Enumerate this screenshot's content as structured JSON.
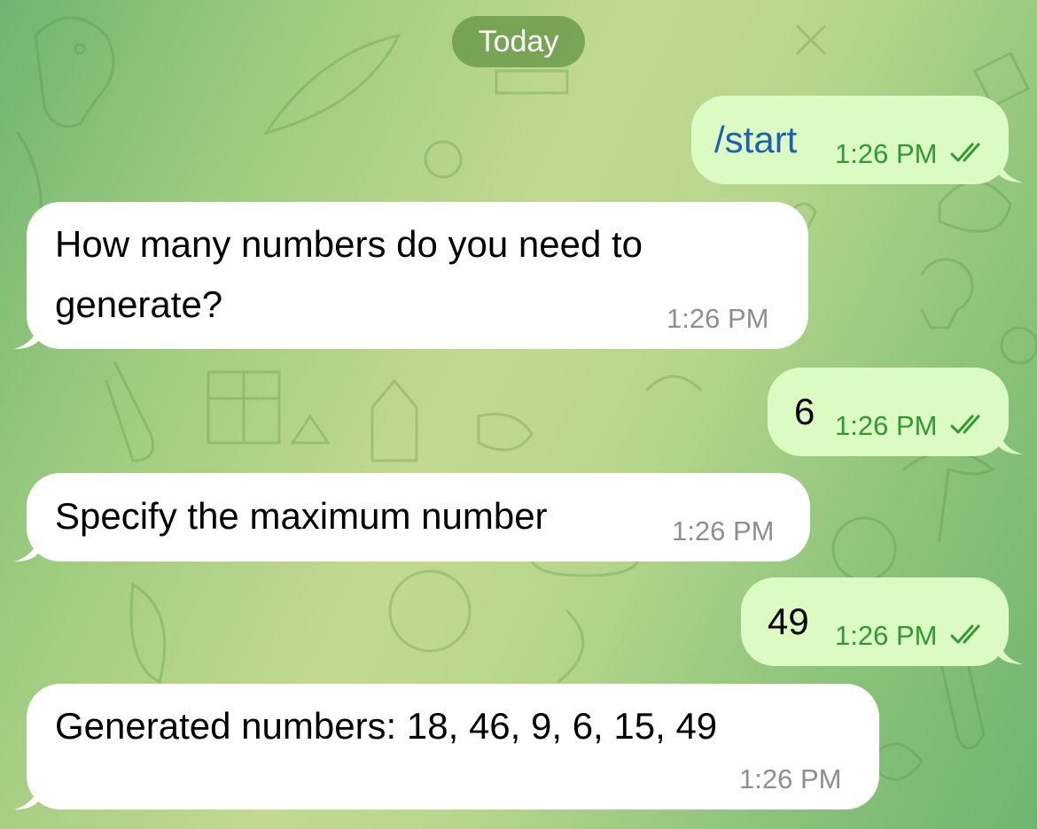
{
  "date_separator": "Today",
  "messages": [
    {
      "direction": "outgoing",
      "text": "/start",
      "is_command": true,
      "time": "1:26 PM",
      "status": "read"
    },
    {
      "direction": "incoming",
      "lines": [
        "How many numbers do you need to",
        "generate?"
      ],
      "time": "1:26 PM"
    },
    {
      "direction": "outgoing",
      "text": "6",
      "time": "1:26 PM",
      "status": "read"
    },
    {
      "direction": "incoming",
      "text": "Specify the maximum number",
      "time": "1:26 PM"
    },
    {
      "direction": "outgoing",
      "text": "49",
      "time": "1:26 PM",
      "status": "read"
    },
    {
      "direction": "incoming",
      "text": "Generated numbers: 18, 46, 9, 6, 15, 49",
      "time": "1:26 PM"
    }
  ],
  "icons": {
    "read_status": "double-check-icon",
    "wallpaper": "doodle-pattern"
  },
  "colors": {
    "incoming_bubble": "#ffffff",
    "outgoing_bubble": "#dcfbc2",
    "outgoing_time": "#2f9a33",
    "incoming_time": "#8e8e93",
    "command_link": "#1d5fb4",
    "date_pill": "#6b9a4a"
  }
}
